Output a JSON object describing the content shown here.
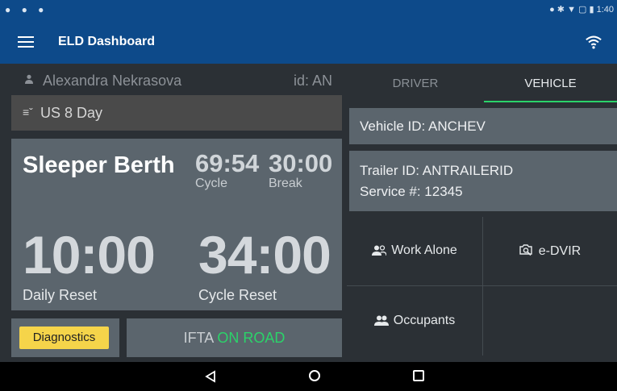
{
  "status_bar": {
    "time": "1:40"
  },
  "appbar": {
    "title": "ELD Dashboard"
  },
  "driver": {
    "name": "Alexandra Nekrasova",
    "id": "id: AN"
  },
  "ruleset": {
    "label": "US 8 Day"
  },
  "hos": {
    "status": "Sleeper Berth",
    "cycle_value": "69:54",
    "cycle_label": "Cycle",
    "break_value": "30:00",
    "break_label": "Break",
    "daily_reset_value": "10:00",
    "daily_reset_label": "Daily Reset",
    "cycle_reset_value": "34:00",
    "cycle_reset_label": "Cycle Reset"
  },
  "diagnostics_label": "Diagnostics",
  "ifta": {
    "label": "IFTA",
    "status": "ON ROAD"
  },
  "tabs": [
    {
      "label": "DRIVER"
    },
    {
      "label": "VEHICLE"
    }
  ],
  "vehicle": {
    "vehicle_id": "Vehicle ID:  ANCHEV",
    "trailer_id": "Trailer ID:  ANTRAILERID",
    "service": "Service #:  12345"
  },
  "actions": {
    "work_alone": "Work Alone",
    "edvir": "e-DVIR",
    "occupants": "Occupants"
  },
  "colors": {
    "primary": "#0d4a8a",
    "accent_green": "#2bd36a",
    "diagnostics_yellow": "#f5d44a"
  }
}
